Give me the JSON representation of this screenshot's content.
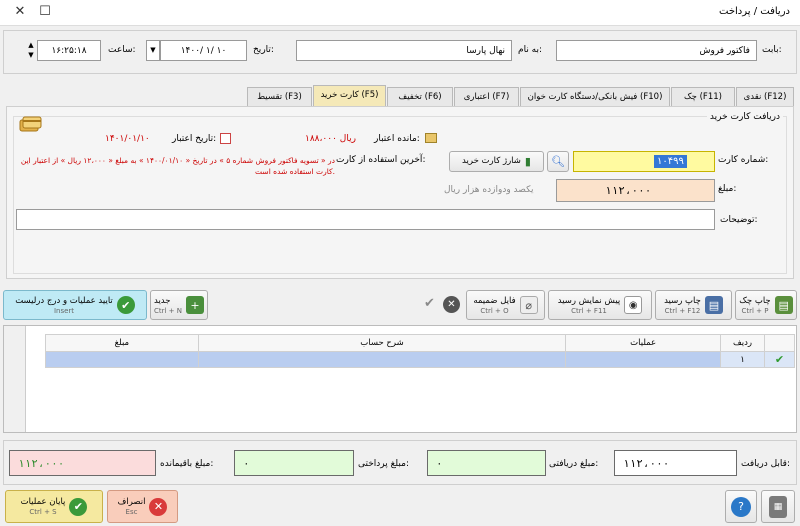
{
  "window": {
    "title": "دریافت / پرداخت",
    "maximize_icon": "maximize-icon",
    "close_icon": "close-icon"
  },
  "header": {
    "party_label": "بابت:",
    "party_value": "فاکتور فروش",
    "name_label": "به نام:",
    "name_value": "نهال پارسا",
    "date_label": "تاریخ:",
    "date_value": "۱۴۰۰/ ۱/ ۱۰",
    "time_label": "ساعت:",
    "time_value": "۱۶:۲۵:۱۸"
  },
  "tabs": [
    {
      "label": "نقدی (F12)"
    },
    {
      "label": "چک (F11)"
    },
    {
      "label": "فیش بانکی/دستگاه کارت خوان (F10)"
    },
    {
      "label": "اعتباری (F7)"
    },
    {
      "label": "تخفیف (F6)"
    },
    {
      "label": "کارت خرید (F5)"
    },
    {
      "label": "تقسیط (F3)"
    }
  ],
  "card": {
    "group_title": "دریافت کارت خرید",
    "card_label": "شماره کارت:",
    "card_value": "۱۰۴۹۹",
    "charge_btn": "شارژ کارت خرید",
    "amount_label": "مبلغ:",
    "amount_value": "۱۱۲،۰۰۰",
    "amount_words": "یکصد ودوازده هزار ریال",
    "desc_label": "توضیحات:",
    "desc_value": "",
    "balance_label": "مانده اعتبار:",
    "balance_value": "۱۸۸،۰۰۰ ریال",
    "credit_date_label": "تاریخ اعتبار:",
    "credit_date_value": "۱۴۰۱/۰۱/۱۰",
    "last_use_label": "آخرین استفاده از کارت:",
    "last_use_text": "در « تسویه فاکتور فروش شماره ۵ » در تاریخ « ۱۴۰۰/۰۱/۱۰ » به مبلغ « ۱۲،۰۰۰ ریال » از اعتبار این کارت استفاده شده است."
  },
  "toolbar": {
    "print_check": {
      "label": "چاپ چک",
      "shortcut": "Ctrl + P"
    },
    "print_receipt": {
      "label": "چاپ رسید",
      "shortcut": "Ctrl + F12"
    },
    "preview_receipt": {
      "label": "پیش نمایش رسید",
      "shortcut": "Ctrl + F11"
    },
    "attachment": {
      "label": "فایل ضمیمه",
      "shortcut": "Ctrl + O"
    },
    "new": {
      "label": "جدید",
      "shortcut": "Ctrl + N"
    },
    "confirm": {
      "label": "تایید عملیات و درج درلیست",
      "shortcut": "Insert"
    }
  },
  "grid": {
    "headers": {
      "row": "ردیف",
      "ops": "عملیات",
      "desc": "شرح حساب",
      "amount": "مبلغ"
    },
    "rows": [
      {
        "row": "۱",
        "ops": "",
        "desc": "",
        "amount": ""
      }
    ]
  },
  "summary": {
    "payable_label": "قابل دریافت:",
    "payable_value": "۱۱۲،۰۰۰",
    "received_label": "مبلغ دریافتی:",
    "received_value": "۰",
    "paid_label": "مبلغ پرداختی:",
    "paid_value": "۰",
    "remaining_label": "مبلغ باقیمانده:",
    "remaining_value": "۱۱۲،۰۰۰"
  },
  "footer": {
    "finish": {
      "label": "پایان عملیات",
      "shortcut": "Ctrl + S"
    },
    "cancel": {
      "label": "انصراف",
      "shortcut": "Esc"
    }
  },
  "colors": {
    "tab_active": "#f5e9b8",
    "card_input": "#fffaa0",
    "amount_bg": "#fbe2cb",
    "received_bg": "#e2fbd9",
    "remaining_bg": "#fbdcdc",
    "confirm_bg": "#bfeaf5",
    "finish_bg": "#f5e9a0",
    "cancel_bg": "#f9cdbb",
    "red_text": "#cc0000"
  }
}
